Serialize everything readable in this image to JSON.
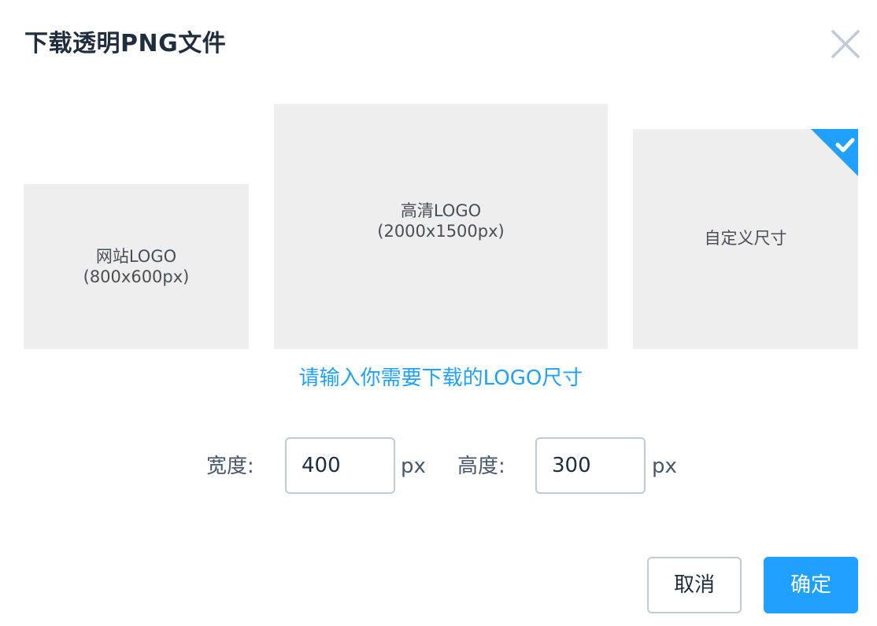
{
  "dialog": {
    "title": "下载透明PNG文件",
    "close_icon": "close-icon"
  },
  "options": [
    {
      "id": "website",
      "line1": "网站LOGO",
      "line2": "(800x600px)",
      "selected": false
    },
    {
      "id": "hd",
      "line1": "高清LOGO",
      "line2": "(2000x1500px)",
      "selected": false
    },
    {
      "id": "custom",
      "line1": "自定义尺寸",
      "line2": "",
      "selected": true,
      "badge_icon": "checkmark-icon"
    }
  ],
  "hint": "请输入你需要下载的LOGO尺寸",
  "size": {
    "width_label": "宽度:",
    "width_value": "400",
    "width_unit": "px",
    "height_label": "高度:",
    "height_value": "300",
    "height_unit": "px"
  },
  "buttons": {
    "cancel": "取消",
    "confirm": "确定"
  },
  "colors": {
    "accent": "#20a0ff",
    "option_bg": "#eeeeee",
    "border": "#bfcbd9",
    "text": "#1f2d3d"
  }
}
